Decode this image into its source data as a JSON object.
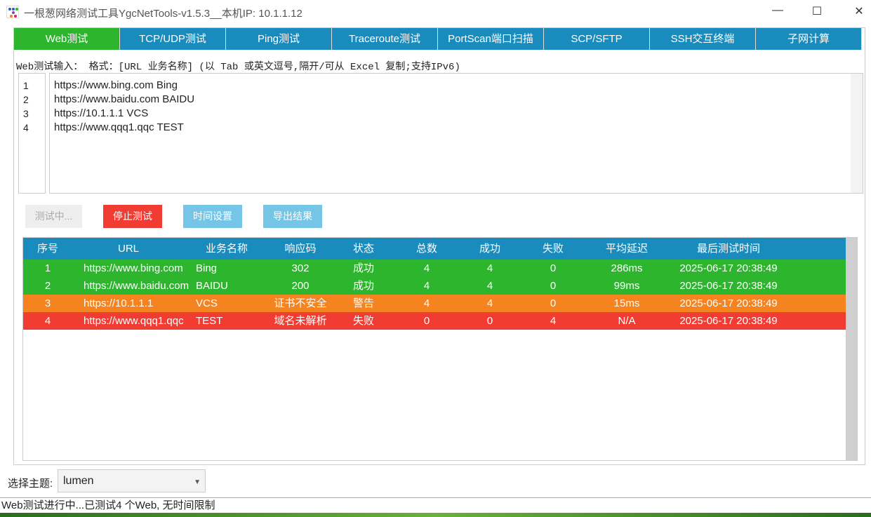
{
  "window": {
    "title": "一根葱网络测试工具YgcNetTools-v1.5.3__本机IP: 10.1.1.12",
    "min": "—",
    "max": "☐",
    "close": "✕"
  },
  "tabs": [
    "Web测试",
    "TCP/UDP测试",
    "Ping测试",
    "Traceroute测试",
    "PortScan端口扫描",
    "SCP/SFTP",
    "SSH交互终端",
    "子网计算"
  ],
  "hint": "Web测试输入： 格式：[URL 业务名称] (以 Tab 或英文逗号,隔开/可从 Excel 复制;支持IPv6)",
  "editor": {
    "line_numbers": [
      "1",
      "2",
      "3",
      "4"
    ],
    "lines": [
      "https://www.bing.com Bing",
      "https://www.baidu.com BAIDU",
      "https://10.1.1.1 VCS",
      "https://www.qqq1.qqc TEST"
    ]
  },
  "buttons": {
    "testing": "测试中...",
    "stop": "停止测试",
    "time": "时间设置",
    "export": "导出结果"
  },
  "table": {
    "headers": [
      "序号",
      "URL",
      "业务名称",
      "响应码",
      "状态",
      "总数",
      "成功",
      "失败",
      "平均延迟",
      "最后测试时间"
    ],
    "rows": [
      [
        "1",
        "https://www.bing.com",
        "Bing",
        "302",
        "成功",
        "4",
        "4",
        "0",
        "286ms",
        "2025-06-17 20:38:49"
      ],
      [
        "2",
        "https://www.baidu.com",
        "BAIDU",
        "200",
        "成功",
        "4",
        "4",
        "0",
        "99ms",
        "2025-06-17 20:38:49"
      ],
      [
        "3",
        "https://10.1.1.1",
        "VCS",
        "证书不安全",
        "警告",
        "4",
        "4",
        "0",
        "15ms",
        "2025-06-17 20:38:49"
      ],
      [
        "4",
        "https://www.qqq1.qqc",
        "TEST",
        "域名未解析",
        "失败",
        "0",
        "0",
        "4",
        "N/A",
        "2025-06-17 20:38:49"
      ]
    ],
    "row_colors": [
      "#2db52d",
      "#2db52d",
      "#f5831f",
      "#f03c32"
    ]
  },
  "theme": {
    "label": "选择主题:",
    "value": "lumen"
  },
  "status": "Web测试进行中...已测试4 个Web, 无时间限制"
}
